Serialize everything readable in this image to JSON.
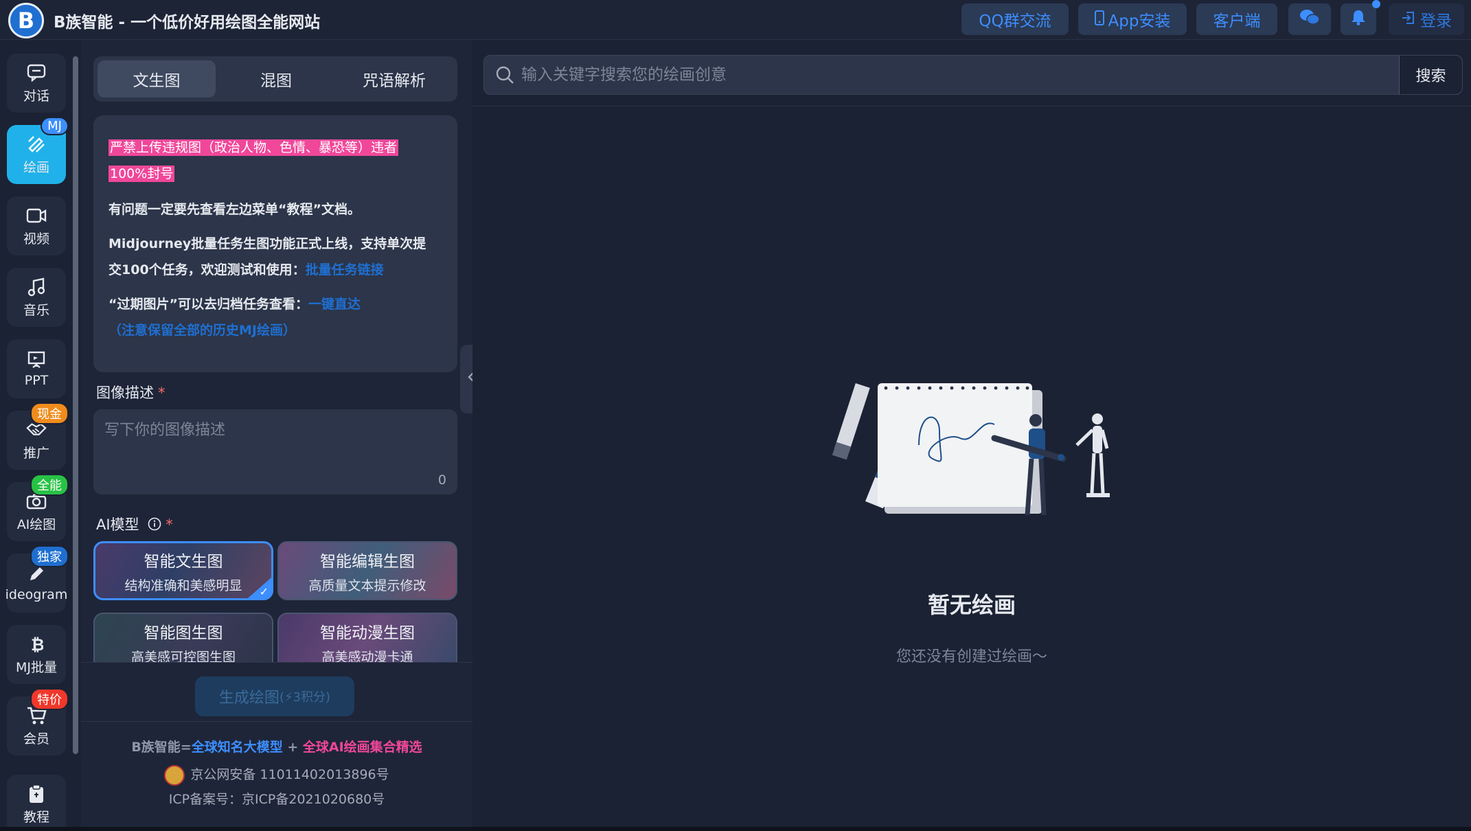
{
  "header": {
    "logo_letter": "B",
    "title": "B族智能 - 一个低价好用绘图全能网站",
    "buttons": {
      "qq": "QQ群交流",
      "app": "App安装",
      "client": "客户端",
      "login": "登录"
    }
  },
  "nav": {
    "items": [
      {
        "label": "对话",
        "badge": ""
      },
      {
        "label": "绘画",
        "badge": "MJ"
      },
      {
        "label": "视频",
        "badge": ""
      },
      {
        "label": "音乐",
        "badge": ""
      },
      {
        "label": "PPT",
        "badge": ""
      },
      {
        "label": "推广",
        "badge": "现金"
      },
      {
        "label": "AI绘图",
        "badge": "全能"
      },
      {
        "label": "ideogram",
        "badge": "独家"
      },
      {
        "label": "MJ批量",
        "badge": ""
      },
      {
        "label": "会员",
        "badge": "特价"
      },
      {
        "label": "教程",
        "badge": ""
      }
    ],
    "badge_colors": {
      "MJ": "#3d8eff",
      "现金": "#f08c1c",
      "全能": "#28c245",
      "独家": "#1f6fd1",
      "特价": "#f0382b"
    }
  },
  "panel": {
    "tabs": [
      "文生图",
      "混图",
      "咒语解析"
    ],
    "notice": {
      "warning_line1": "严禁上传违规图（政治人物、色情、暴恐等）违者",
      "warning_line2": "100%封号",
      "p1": "有问题一定要先查看左边菜单“教程”文档。",
      "p2_line1": "Midjourney批量任务生图功能正式上线，支持单次提",
      "p2_line2": "交100个任务，欢迎测试和使用：",
      "p2_link": "批量任务链接",
      "p3_text": "“过期图片”可以去归档任务查看：",
      "p3_link1": "一键直达",
      "p3_link2": "（注意保留全部的历史MJ绘画）"
    },
    "desc_label": "图像描述",
    "desc_placeholder": "写下你的图像描述",
    "desc_count": "0",
    "model_label": "AI模型",
    "models": [
      {
        "title": "智能文生图",
        "sub": "结构准确和美感明显"
      },
      {
        "title": "智能编辑生图",
        "sub": "高质量文本提示修改"
      },
      {
        "title": "智能图生图",
        "sub": "高美感可控图生图"
      },
      {
        "title": "智能动漫生图",
        "sub": "高美感动漫卡通"
      }
    ],
    "generate": {
      "label": "生成绘图",
      "cost": "(⚡3积分)"
    },
    "footer": {
      "brand": "B族智能=",
      "part1": "全球知名大模型",
      "plus": "+",
      "part2": "全球AI绘画集合精选",
      "police": "京公网安备 11011402013896号",
      "icp": "ICP备案号：京ICP备2021020680号"
    }
  },
  "main": {
    "search_placeholder": "输入关键字搜索您的绘画创意",
    "search_button": "搜索",
    "empty_title": "暂无绘画",
    "empty_sub": "您还没有创建过绘画～"
  },
  "colors": {
    "accent": "#3d8eff",
    "warning": "#f0479a",
    "active_nav": "#20b1ea"
  }
}
